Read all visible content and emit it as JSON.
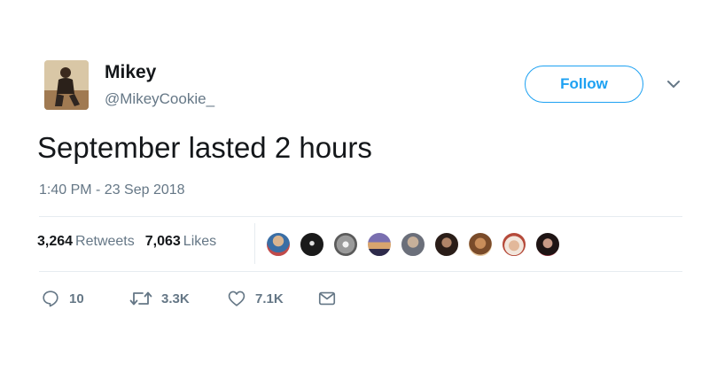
{
  "user": {
    "name": "Mikey",
    "handle": "@MikeyCookie_"
  },
  "follow_label": "Follow",
  "tweet": {
    "text": "September lasted 2 hours",
    "timestamp": "1:40 PM - 23 Sep 2018"
  },
  "stats": {
    "retweets_count": "3,264",
    "retweets_label": "Retweets",
    "likes_count": "7,063",
    "likes_label": "Likes"
  },
  "liker_avatars": [
    "liker-avatar-1",
    "liker-avatar-2",
    "liker-avatar-3",
    "liker-avatar-4",
    "liker-avatar-5",
    "liker-avatar-6",
    "liker-avatar-7",
    "liker-avatar-8",
    "liker-avatar-9"
  ],
  "actions": {
    "reply_count": "10",
    "retweet_count": "3.3K",
    "like_count": "7.1K"
  },
  "icons": {
    "reply": "reply-icon",
    "retweet": "retweet-icon",
    "like": "heart-icon",
    "dm": "envelope-icon",
    "caret": "chevron-down-icon"
  },
  "colors": {
    "accent": "#1da1f2",
    "text": "#14171a",
    "secondary": "#657786",
    "divider": "#e6ecf0"
  }
}
